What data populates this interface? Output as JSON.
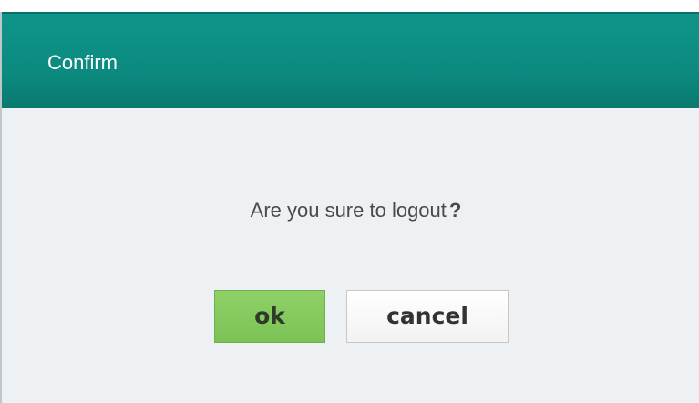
{
  "dialog": {
    "title": "Confirm",
    "message": "Are you sure to logout",
    "question_mark": "?",
    "ok_label": "ok",
    "cancel_label": "cancel"
  },
  "colors": {
    "titlebar": "#0c8b80",
    "body_background": "#eef1f4",
    "ok_button": "#7cc356",
    "cancel_button": "#f7f7f7"
  }
}
